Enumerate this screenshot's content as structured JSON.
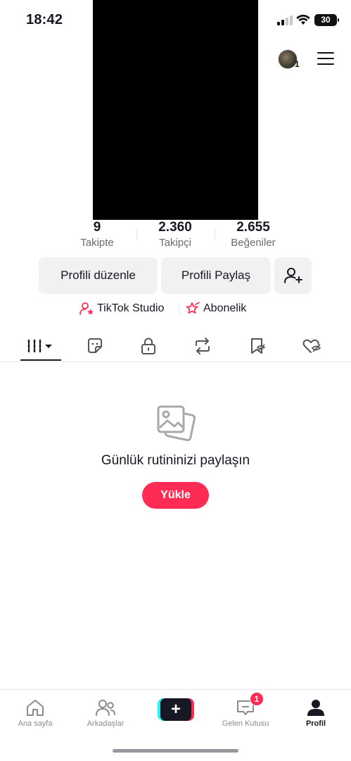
{
  "status_bar": {
    "time": "18:42",
    "battery": "30"
  },
  "profile": {
    "avatar_count": "1"
  },
  "stats": [
    {
      "value": "9",
      "label": "Takipte"
    },
    {
      "value": "2.360",
      "label": "Takipçi"
    },
    {
      "value": "2.655",
      "label": "Beğeniler"
    }
  ],
  "actions": {
    "edit_profile": "Profili düzenle",
    "share_profile": "Profili Paylaş"
  },
  "links": {
    "studio": "TikTok Studio",
    "subscription": "Abonelik"
  },
  "tabs": [
    "videos-grid-icon",
    "stickers-icon",
    "lock-icon",
    "repost-icon",
    "favorites-icon",
    "liked-icon"
  ],
  "empty_state": {
    "title": "Günlük rutininizi paylaşın",
    "button": "Yükle"
  },
  "bottom_nav": {
    "home": "Ana sayfa",
    "friends": "Arkadaşlar",
    "create": "+",
    "inbox": "Gelen Kutusu",
    "inbox_badge": "1",
    "profile": "Profil"
  },
  "colors": {
    "accent": "#fe2c55",
    "cyan": "#25f4ee",
    "text": "#161823",
    "button_bg": "#f1f1f2"
  }
}
